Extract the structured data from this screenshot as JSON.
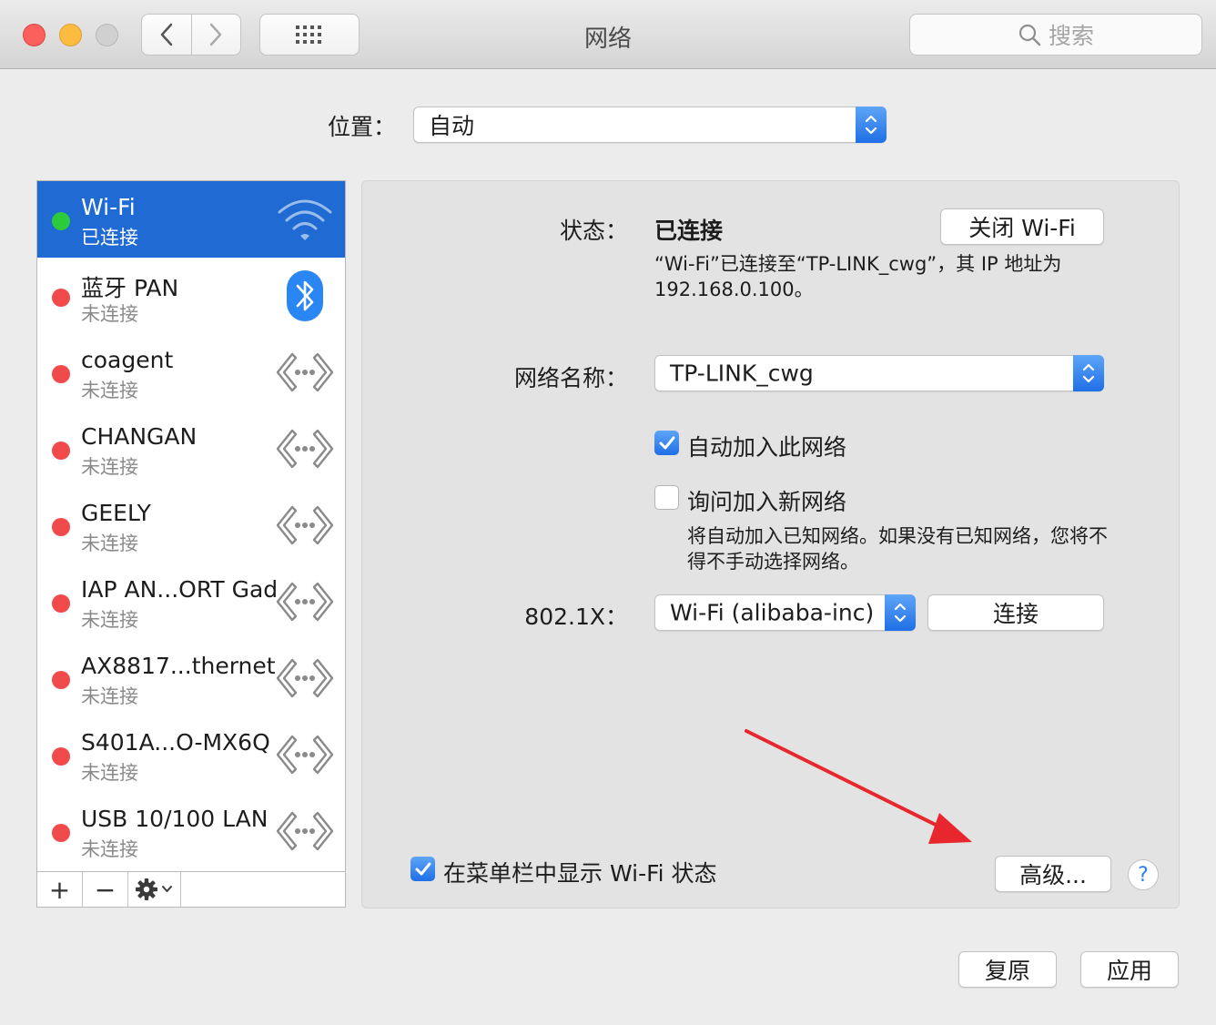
{
  "window": {
    "title": "网络",
    "search_placeholder": "搜索"
  },
  "location": {
    "label": "位置：",
    "value": "自动"
  },
  "services": [
    {
      "name": "Wi-Fi",
      "status": "已连接",
      "dot": "green",
      "icon": "wifi-icon",
      "selected": true
    },
    {
      "name": "蓝牙 PAN",
      "status": "未连接",
      "dot": "red",
      "icon": "bluetooth-icon"
    },
    {
      "name": "coagent",
      "status": "未连接",
      "dot": "red",
      "icon": "ethernet-icon"
    },
    {
      "name": "CHANGAN",
      "status": "未连接",
      "dot": "red",
      "icon": "ethernet-icon"
    },
    {
      "name": "GEELY",
      "status": "未连接",
      "dot": "red",
      "icon": "ethernet-icon"
    },
    {
      "name": "IAP AN...ORT Gad",
      "status": "未连接",
      "dot": "red",
      "icon": "ethernet-icon"
    },
    {
      "name": "AX8817...thernet",
      "status": "未连接",
      "dot": "red",
      "icon": "ethernet-icon"
    },
    {
      "name": "S401A...O-MX6Q",
      "status": "未连接",
      "dot": "red",
      "icon": "ethernet-icon"
    },
    {
      "name": "USB 10/100 LAN",
      "status": "未连接",
      "dot": "red",
      "icon": "ethernet-icon"
    }
  ],
  "sidebar_buttons": {
    "add": "+",
    "remove": "−"
  },
  "detail": {
    "status_label": "状态：",
    "status_value": "已连接",
    "turn_off_button": "关闭 Wi-Fi",
    "status_desc_line1": "“Wi-Fi”已连接至“TP-LINK_cwg”，其 IP 地址为",
    "status_desc_line2": "192.168.0.100。",
    "network_name_label": "网络名称：",
    "network_name_value": "TP-LINK_cwg",
    "auto_join_label": "自动加入此网络",
    "auto_join_checked": true,
    "ask_join_label": "询问加入新网络",
    "ask_join_checked": false,
    "ask_join_desc_line1": "将自动加入已知网络。如果没有已知网络，您将不",
    "ask_join_desc_line2": "得不手动选择网络。",
    "dot1x_label": "802.1X：",
    "dot1x_value": "Wi-Fi (alibaba-inc)",
    "connect_button": "连接",
    "show_menu_label": "在菜单栏中显示 Wi-Fi 状态",
    "show_menu_checked": true,
    "advanced_button": "高级...",
    "help_button": "?"
  },
  "footer": {
    "revert_button": "复原",
    "apply_button": "应用"
  },
  "colors": {
    "selection": "#1f6ad3",
    "connected": "#2bcb3d",
    "disconnected": "#f14a4a",
    "annotation_arrow": "#e8262d"
  }
}
